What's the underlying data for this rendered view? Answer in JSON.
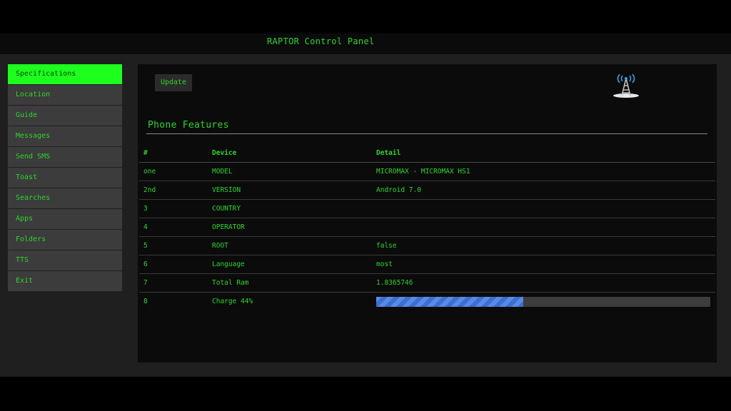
{
  "window": {
    "title": "RAPTOR Control Panel"
  },
  "sidebar": {
    "items": [
      {
        "label": "Specifications",
        "active": true
      },
      {
        "label": "Location"
      },
      {
        "label": "Guide"
      },
      {
        "label": "Messages"
      },
      {
        "label": "Send SMS"
      },
      {
        "label": "Toast"
      },
      {
        "label": "Searches"
      },
      {
        "label": "Apps"
      },
      {
        "label": "Folders"
      },
      {
        "label": "TTS"
      },
      {
        "label": "Exit"
      }
    ]
  },
  "toolbar": {
    "update_label": "Update",
    "icon": "signal-tower-icon"
  },
  "section": {
    "title": "Phone Features"
  },
  "table": {
    "headers": [
      "#",
      "Device",
      "Detail"
    ],
    "rows": [
      {
        "num": "one",
        "device": "MODEL",
        "detail": "MICROMAX - MICROMAX HS1"
      },
      {
        "num": "2nd",
        "device": "VERSION",
        "detail": "Android 7.0"
      },
      {
        "num": "3",
        "device": "COUNTRY",
        "detail": ""
      },
      {
        "num": "4",
        "device": "OPERATOR",
        "detail": ""
      },
      {
        "num": "5",
        "device": "ROOT",
        "detail": "false"
      },
      {
        "num": "6",
        "device": "Language",
        "detail": "most"
      },
      {
        "num": "7",
        "device": "Total Ram",
        "detail": "1.8365746"
      },
      {
        "num": "8",
        "device": "Charge 44%",
        "detail": ""
      }
    ],
    "charge_progress": 0.44
  },
  "colors": {
    "accent": "#2dd52d",
    "active_nav": "#1dff1d",
    "progress": "#3b6fd0"
  }
}
